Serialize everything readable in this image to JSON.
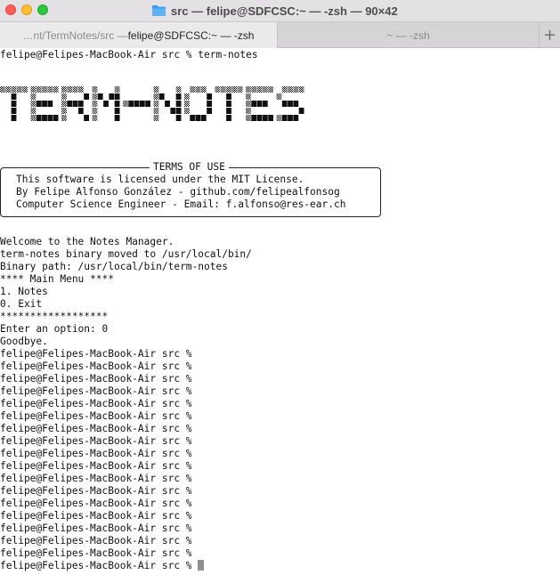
{
  "window": {
    "title": "src — felipe@SDFCSC:~ — -zsh — 90×42"
  },
  "tabs": [
    {
      "path_prefix": "…nt/TermNotes/src — ",
      "label": "felipe@SDFCSC:~ — -zsh",
      "active": true
    },
    {
      "label": "~ — -zsh",
      "active": false
    }
  ],
  "new_tab_icon": "plus-icon",
  "terminal": {
    "command_line": "felipe@Felipes-MacBook-Air src % term-notes",
    "logo_text": "TERM-NOTES",
    "terms_title": "TERMS OF USE",
    "terms_lines": [
      "This software is licensed under the MIT License.",
      "By Felipe Alfonso González - github.com/felipealfonsog",
      "Computer Science Engineer - Email: f.alfonso@res-ear.ch"
    ],
    "output_lines": [
      "Welcome to the Notes Manager.",
      "term-notes binary moved to /usr/local/bin/",
      "Binary path: /usr/local/bin/term-notes",
      "**** Main Menu ****",
      "1. Notes",
      "0. Exit",
      "******************",
      "Enter an option: 0",
      "Goodbye."
    ],
    "prompt": "felipe@Felipes-MacBook-Air src %",
    "prompt_repeat_count": 18
  },
  "colors": {
    "close": "#fe5f57",
    "minimize": "#febc2e",
    "maximize": "#28c840",
    "folder": "#3b9cf5"
  }
}
